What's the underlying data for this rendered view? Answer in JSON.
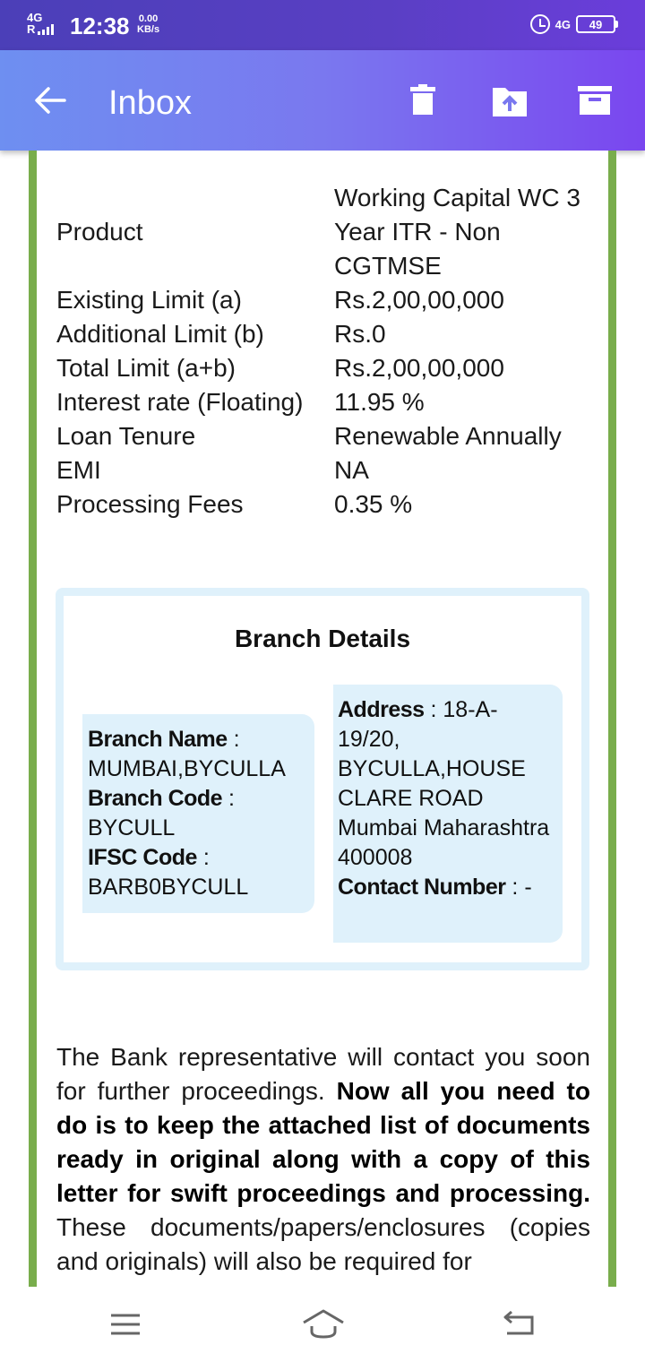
{
  "status_bar": {
    "network": "4G",
    "roaming": "R",
    "time": "12:38",
    "speed_value": "0.00",
    "speed_unit": "KB/s",
    "network_right": "4G",
    "battery": "49",
    "icons": [
      "signal-icon",
      "alarm-icon",
      "battery-icon"
    ]
  },
  "app_bar": {
    "title": "Inbox",
    "icons": [
      "back-arrow-icon",
      "delete-icon",
      "move-to-folder-icon",
      "archive-icon"
    ]
  },
  "loan_details": [
    {
      "label": "Product",
      "value": "Working Capital WC 3 Year ITR - Non CGTMSE"
    },
    {
      "label": "Existing Limit (a)",
      "value": "Rs.2,00,00,000"
    },
    {
      "label": "Additional Limit (b)",
      "value": "Rs.0"
    },
    {
      "label": "Total Limit (a+b)",
      "value": "Rs.2,00,00,000"
    },
    {
      "label": "Interest rate (Floating)",
      "value": "11.95 %"
    },
    {
      "label": "Loan Tenure",
      "value": "Renewable Annually"
    },
    {
      "label": "EMI",
      "value": "NA"
    },
    {
      "label": "Processing Fees",
      "value": "0.35 %"
    }
  ],
  "branch": {
    "title": "Branch Details",
    "branch_name_label": "Branch Name",
    "branch_name": "MUMBAI,BYCULLA",
    "branch_code_label": "Branch Code",
    "branch_code": "BYCULL",
    "ifsc_label": "IFSC Code",
    "ifsc": "BARB0BYCULL",
    "address_label": "Address",
    "address": "18-A-19/20, BYCULLA,HOUSE CLARE ROAD Mumbai Maharashtra 400008",
    "contact_label": "Contact Number",
    "contact": "-"
  },
  "message": {
    "normal_1": "The Bank representative will contact you soon for further proceedings. ",
    "bold_1": "Now all you need to do is to keep the attached list of documents ready in original along with a copy of this letter for swift proceedings and processing.",
    "normal_2": " These documents/papers/enclosures (copies and originals) will also be required for"
  },
  "nav_bar": {
    "icons": [
      "menu-icon",
      "home-icon",
      "back-icon"
    ]
  }
}
